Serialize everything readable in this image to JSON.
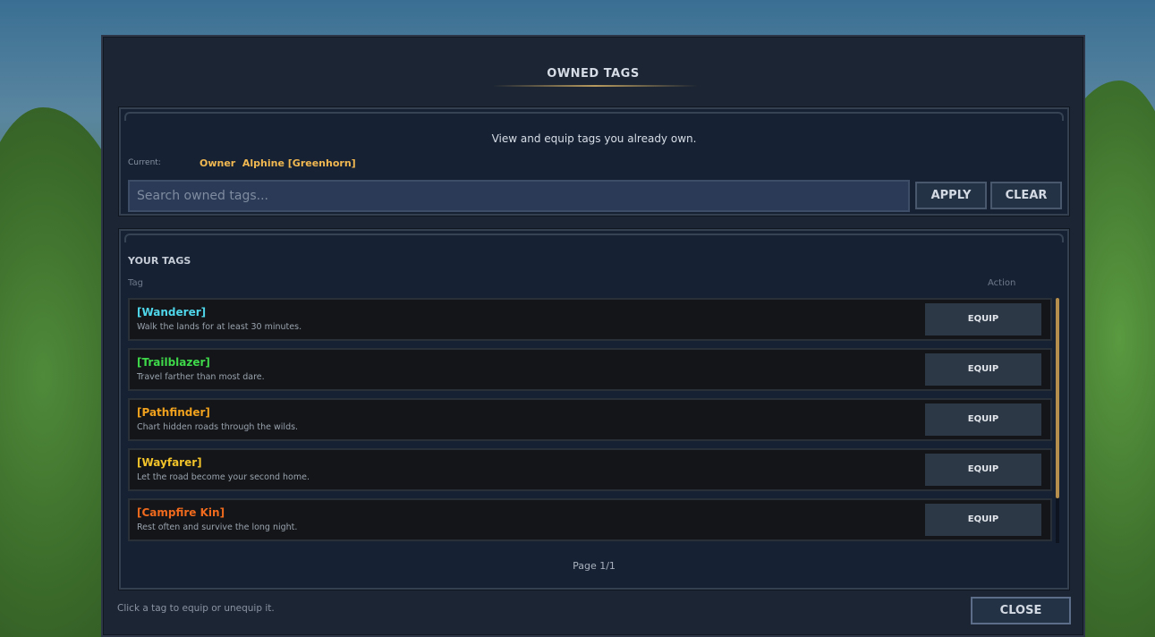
{
  "dialog": {
    "title": "OWNED TAGS",
    "description": "View and equip tags you already own.",
    "current_label": "Current:",
    "current_value": "Owner  Alphine [Greenhorn]",
    "search": {
      "value": "",
      "placeholder": "Search owned tags..."
    },
    "apply_label": "APPLY",
    "clear_label": "CLEAR",
    "section_title": "YOUR TAGS",
    "columns": {
      "tag": "Tag",
      "action": "Action"
    },
    "tags": [
      {
        "name": "[Wanderer]",
        "description": "Walk the lands for at least 30 minutes.",
        "color": "#4fd6ea",
        "action": "EQUIP"
      },
      {
        "name": "[Trailblazer]",
        "description": "Travel farther than most dare.",
        "color": "#3ed84a",
        "action": "EQUIP"
      },
      {
        "name": "[Pathfinder]",
        "description": "Chart hidden roads through the wilds.",
        "color": "#f0a21e",
        "action": "EQUIP"
      },
      {
        "name": "[Wayfarer]",
        "description": "Let the road become your second home.",
        "color": "#f2c32a",
        "action": "EQUIP"
      },
      {
        "name": "[Campfire Kin]",
        "description": "Rest often and survive the long night.",
        "color": "#f06a1e",
        "action": "EQUIP"
      }
    ],
    "page_indicator": "Page 1/1",
    "hint": "Click a tag to equip or unequip it.",
    "close_label": "CLOSE",
    "accent_color": "#b58d4c"
  }
}
